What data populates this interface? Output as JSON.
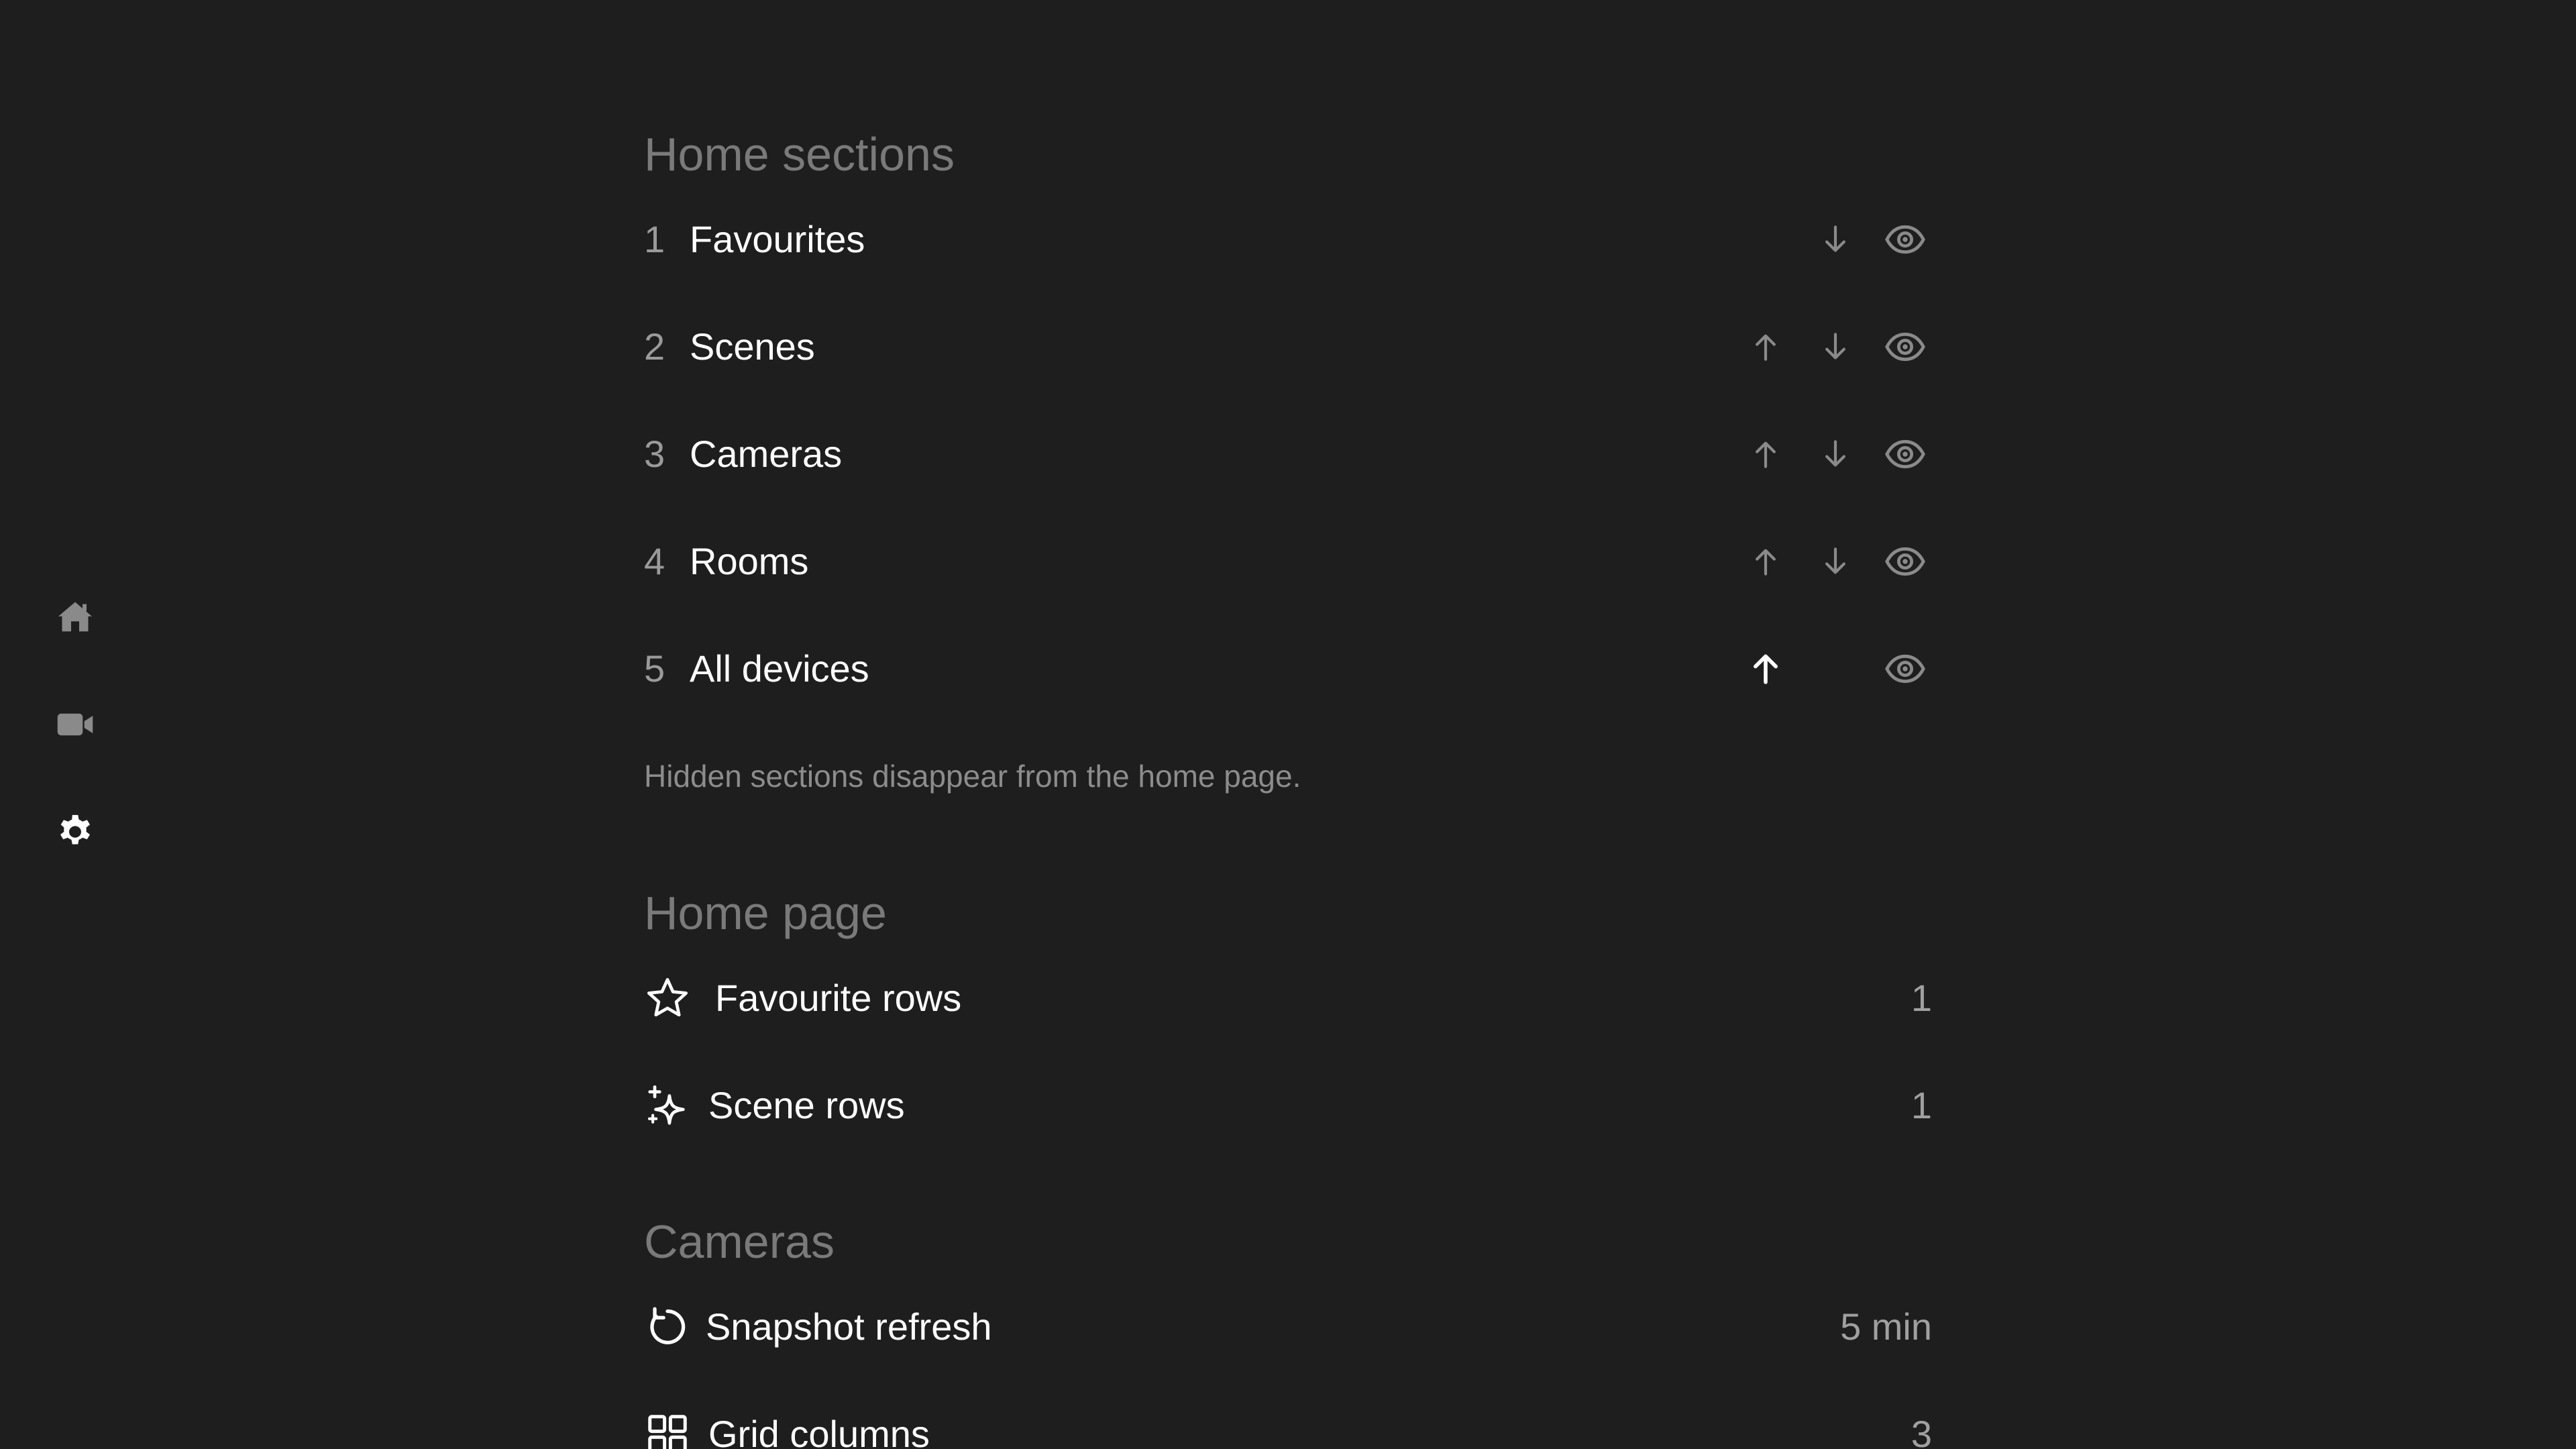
{
  "sidebar": {
    "items": [
      {
        "name": "Home",
        "icon": "home-icon",
        "active": false
      },
      {
        "name": "Cameras",
        "icon": "video-camera-icon",
        "active": false
      },
      {
        "name": "Settings",
        "icon": "gear-icon",
        "active": true
      }
    ]
  },
  "home_sections": {
    "title": "Home sections",
    "items": [
      {
        "index": "1",
        "label": "Favourites",
        "can_up": false,
        "can_down": true,
        "visible": true
      },
      {
        "index": "2",
        "label": "Scenes",
        "can_up": true,
        "can_down": true,
        "visible": true
      },
      {
        "index": "3",
        "label": "Cameras",
        "can_up": true,
        "can_down": true,
        "visible": true
      },
      {
        "index": "4",
        "label": "Rooms",
        "can_up": true,
        "can_down": true,
        "visible": true
      },
      {
        "index": "5",
        "label": "All devices",
        "can_up": true,
        "can_down": false,
        "visible": true,
        "focused_control": "up"
      }
    ],
    "hint": "Hidden sections disappear from the home page."
  },
  "home_page": {
    "title": "Home page",
    "favourite_rows": {
      "label": "Favourite rows",
      "value": "1",
      "icon": "star-icon"
    },
    "scene_rows": {
      "label": "Scene rows",
      "value": "1",
      "icon": "sparkles-icon"
    }
  },
  "cameras": {
    "title": "Cameras",
    "snapshot_refresh": {
      "label": "Snapshot refresh",
      "value": "5 min",
      "icon": "refresh-icon"
    },
    "grid_columns": {
      "label": "Grid columns",
      "value": "3",
      "icon": "grid-icon"
    }
  },
  "colors": {
    "background": "#1e1e1e",
    "section_title": "#7a7a7a",
    "muted_icon": "#8a8a8a",
    "focused": "#ffffff"
  }
}
